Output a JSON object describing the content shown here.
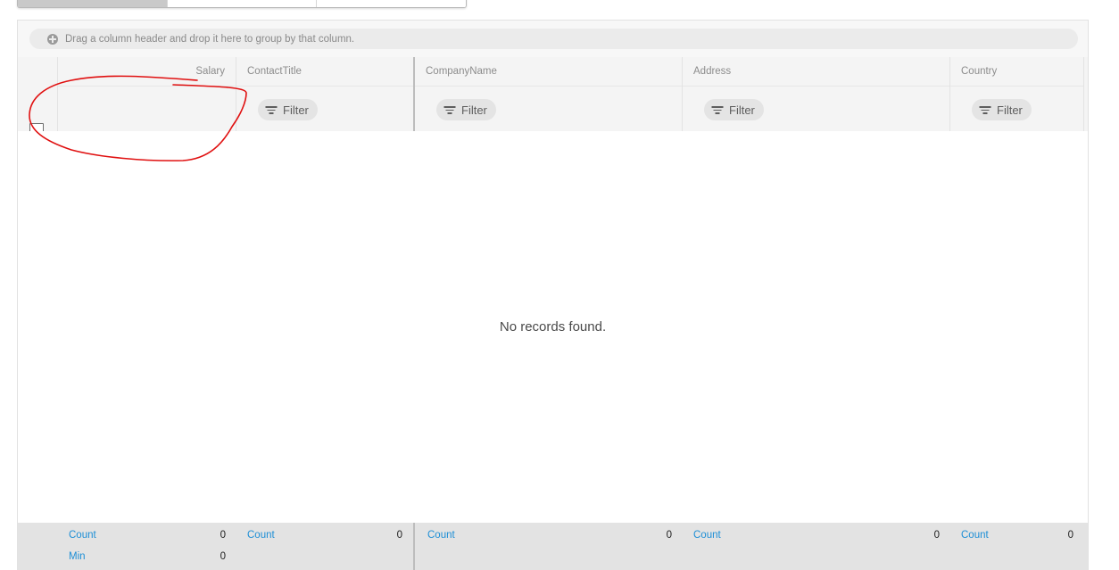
{
  "group_area": {
    "hint": "Drag a column header and drop it here to group by that column."
  },
  "columns": [
    {
      "title": "Salary",
      "filter_label": ""
    },
    {
      "title": "ContactTitle",
      "filter_label": "Filter"
    },
    {
      "title": "CompanyName",
      "filter_label": "Filter"
    },
    {
      "title": "Address",
      "filter_label": "Filter"
    },
    {
      "title": "Country",
      "filter_label": "Filter"
    }
  ],
  "empty_message": "No records found.",
  "summaries": [
    {
      "count_label": "Count",
      "count_value": "0",
      "min_label": "Min",
      "min_value": "0"
    },
    {
      "count_label": "Count",
      "count_value": "0"
    },
    {
      "count_label": "Count",
      "count_value": "0"
    },
    {
      "count_label": "Count",
      "count_value": "0"
    },
    {
      "count_label": "Count",
      "count_value": "0"
    }
  ],
  "colors": {
    "accent": "#1e8fd6",
    "annotation": "#e01010",
    "header_bg": "#f4f4f4",
    "summary_bg": "#e3e3e3"
  }
}
